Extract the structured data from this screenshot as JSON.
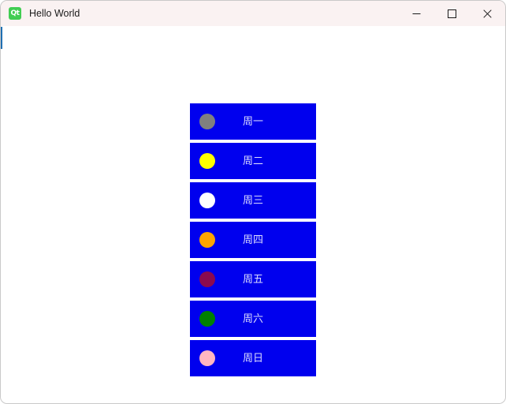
{
  "window": {
    "title": "Hello World",
    "icon": "qt-logo-icon",
    "icon_text": "Qt",
    "background": "#ffffff",
    "titlebar_background": "#faf2f2",
    "border_color": "#c9c9c9",
    "accent_sliver_color": "#1f6fb2"
  },
  "window_controls": {
    "minimize_label": "—",
    "maximize_label": "□",
    "close_label": "✕",
    "minimize_name": "minimize-button",
    "maximize_name": "maximize-button",
    "close_name": "close-button"
  },
  "buttons": {
    "background": "#0000ee",
    "text_color": "#dcdcff",
    "items": [
      {
        "label": "周一",
        "dot_color": "#808080",
        "dot_name": "gray-circle-icon"
      },
      {
        "label": "周二",
        "dot_color": "#ffff00",
        "dot_name": "yellow-circle-icon"
      },
      {
        "label": "周三",
        "dot_color": "#ffffff",
        "dot_name": "white-circle-icon"
      },
      {
        "label": "周四",
        "dot_color": "#ffa500",
        "dot_name": "orange-circle-icon"
      },
      {
        "label": "周五",
        "dot_color": "#8b0a50",
        "dot_name": "crimson-circle-icon"
      },
      {
        "label": "周六",
        "dot_color": "#008000",
        "dot_name": "green-circle-icon"
      },
      {
        "label": "周日",
        "dot_color": "#ffb6c1",
        "dot_name": "pink-circle-icon"
      }
    ]
  }
}
